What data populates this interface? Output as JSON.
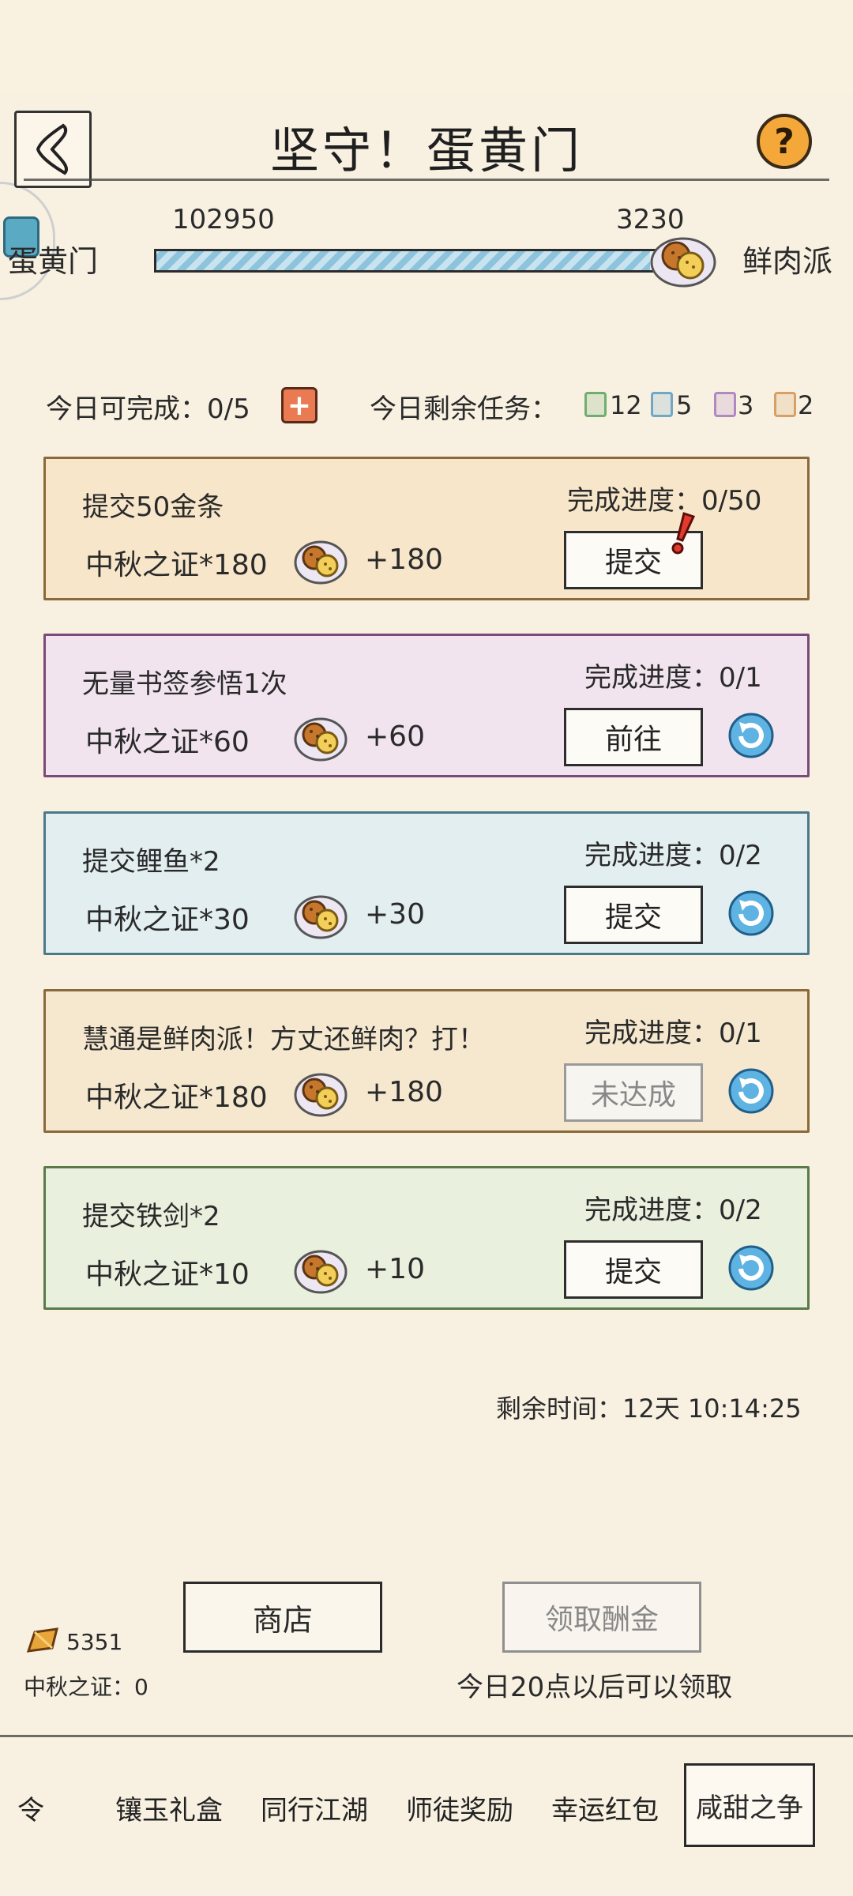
{
  "header": {
    "title": "坚守！蛋黄门"
  },
  "progress": {
    "left_faction": "蛋黄门",
    "right_faction": "鲜肉派",
    "left_score": "102950",
    "right_score": "3230",
    "left_share": 0.97
  },
  "daily": {
    "can_complete": "今日可完成：0/5",
    "remaining_label": "今日剩余任务：",
    "counts": [
      "12",
      "5",
      "3",
      "2"
    ],
    "chip_colors": [
      "#6fae6f",
      "#6fa7c7",
      "#b088c2",
      "#d9a066"
    ]
  },
  "tasks": [
    {
      "title": "提交50金条",
      "reward": "中秋之证*180",
      "points": "+180",
      "progress": "完成进度：0/50",
      "action": "提交",
      "state": "alert",
      "bg": "#f7e6c9",
      "border": "#8a6a3a"
    },
    {
      "title": "无量书签参悟1次",
      "reward": "中秋之证*60",
      "points": "+60",
      "progress": "完成进度：0/1",
      "action": "前往",
      "state": "refresh",
      "bg": "#f1e4ef",
      "border": "#7a4a7a"
    },
    {
      "title": "提交鲤鱼*2",
      "reward": "中秋之证*30",
      "points": "+30",
      "progress": "完成进度：0/2",
      "action": "提交",
      "state": "refresh",
      "bg": "#e2eef0",
      "border": "#4a7a8a"
    },
    {
      "title": "慧通是鲜肉派！方丈还鲜肉？打！",
      "reward": "中秋之证*180",
      "points": "+180",
      "progress": "完成进度：0/1",
      "action": "未达成",
      "state": "refresh-disabled",
      "bg": "#f6e8cf",
      "border": "#8a6a3a"
    },
    {
      "title": "提交铁剑*2",
      "reward": "中秋之证*10",
      "points": "+10",
      "progress": "完成进度：0/2",
      "action": "提交",
      "state": "refresh",
      "bg": "#e9f0de",
      "border": "#5a7a4a"
    }
  ],
  "footer": {
    "remaining_time": "剩余时间：12天 10:14:25",
    "shop": "商店",
    "claim": "领取酬金",
    "claim_note": "今日20点以后可以领取",
    "gold": "5351",
    "zqz": "中秋之证：0"
  },
  "tabs": [
    "令",
    "镶玉礼盒",
    "同行江湖",
    "师徒奖励",
    "幸运红包",
    "咸甜之争"
  ],
  "icons": {
    "back": "back-chevron-icon",
    "help": "help-icon",
    "plus": "plus-icon",
    "mooncake": "mooncake-icon",
    "refresh": "refresh-icon",
    "alert": "exclamation-icon",
    "gold": "gold-bar-icon"
  }
}
